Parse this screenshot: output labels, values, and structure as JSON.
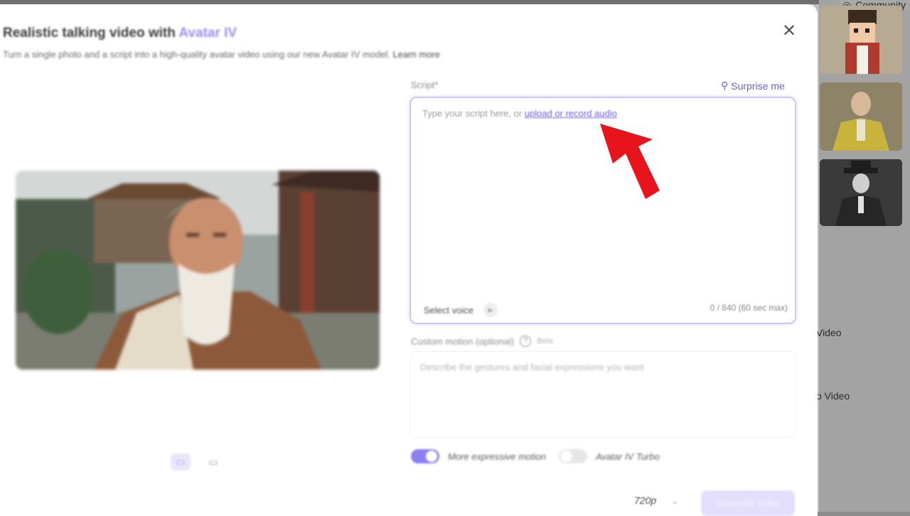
{
  "background": {
    "community_label": "Community",
    "sidebar_items": [
      "Video",
      "o Video"
    ]
  },
  "modal": {
    "title_prefix": "Realistic talking video with ",
    "title_accent": "Avatar IV",
    "subtitle": "Turn a single photo and a script into a high-quality avatar video using our new Avatar IV model.",
    "learn_more": "Learn more",
    "close_icon": "close-icon"
  },
  "script": {
    "label": "Script*",
    "surprise_label": "Surprise me",
    "placeholder_prefix": "Type your script here, or ",
    "upload_link": "upload or record audio",
    "select_voice": "Select voice",
    "char_count": "0 / 840 (60 sec max)"
  },
  "motion": {
    "label": "Custom motion (optional)",
    "beta": "Beta",
    "placeholder": "Describe the gestures and facial expressions you want"
  },
  "toggles": {
    "more_expressive": {
      "label": "More expressive motion",
      "on": true
    },
    "turbo": {
      "label": "Avatar IV Turbo",
      "on": false
    }
  },
  "footer": {
    "resolution": "720p",
    "generate_label": "Generate video"
  },
  "colors": {
    "accent": "#6e5ce6",
    "accent_light": "#e3defc",
    "annotation_arrow": "#e8141c"
  }
}
